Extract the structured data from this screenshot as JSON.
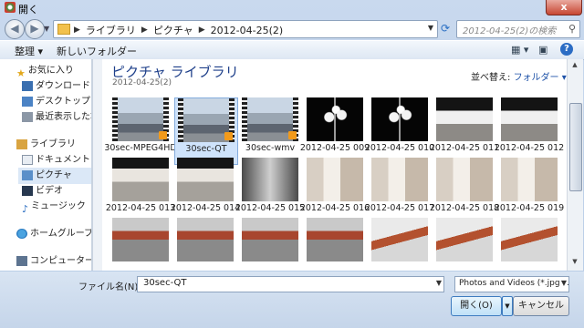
{
  "window": {
    "title": "開く",
    "close_label": "x"
  },
  "nav": {
    "back_icon": "back-arrow-icon",
    "forward_icon": "forward-arrow-icon",
    "breadcrumbs": [
      "ライブラリ",
      "ピクチャ",
      "2012-04-25(2)"
    ],
    "search_placeholder": "2012-04-25(2)の検索"
  },
  "toolbar": {
    "organize": "整理 ▾",
    "new_folder": "新しいフォルダー"
  },
  "sidebar": {
    "items": [
      {
        "label": "お気に入り",
        "icon": "star-icon"
      },
      {
        "label": "ダウンロード",
        "icon": "download-folder-icon"
      },
      {
        "label": "デスクトップ",
        "icon": "desktop-icon"
      },
      {
        "label": "最近表示した場所",
        "icon": "recent-places-icon"
      },
      {
        "label": "ライブラリ",
        "icon": "library-icon"
      },
      {
        "label": "ドキュメント",
        "icon": "documents-icon"
      },
      {
        "label": "ピクチャ",
        "icon": "pictures-icon"
      },
      {
        "label": "ビデオ",
        "icon": "videos-icon"
      },
      {
        "label": "ミュージック",
        "icon": "music-icon"
      },
      {
        "label": "ホームグループ",
        "icon": "homegroup-icon"
      },
      {
        "label": "コンピューター",
        "icon": "computer-icon"
      }
    ]
  },
  "main": {
    "library_title": "ピクチャ ライブラリ",
    "library_sub": "2012-04-25(2)",
    "arrange_label": "並べ替え:",
    "arrange_value": "フォルダー ▾",
    "files": [
      {
        "name": "30sec-MPEG4HD",
        "kind": "video"
      },
      {
        "name": "30sec-QT",
        "kind": "video",
        "selected": true
      },
      {
        "name": "30sec-wmv",
        "kind": "video"
      },
      {
        "name": "2012-04-25 009",
        "kind": "lamp"
      },
      {
        "name": "2012-04-25 010",
        "kind": "lamp"
      },
      {
        "name": "2012-04-25 011",
        "kind": "station"
      },
      {
        "name": "2012-04-25 012",
        "kind": "station"
      },
      {
        "name": "2012-04-25 013",
        "kind": "station2"
      },
      {
        "name": "2012-04-25 014",
        "kind": "station2"
      },
      {
        "name": "2012-04-25 015",
        "kind": "hall"
      },
      {
        "name": "2012-04-25 016",
        "kind": "sign"
      },
      {
        "name": "2012-04-25 017",
        "kind": "sign"
      },
      {
        "name": "2012-04-25 018",
        "kind": "sign"
      },
      {
        "name": "2012-04-25 019",
        "kind": "sign"
      },
      {
        "name": "",
        "kind": "bench"
      },
      {
        "name": "",
        "kind": "bench"
      },
      {
        "name": "",
        "kind": "bench"
      },
      {
        "name": "",
        "kind": "bench"
      },
      {
        "name": "",
        "kind": "bench2"
      },
      {
        "name": "",
        "kind": "bench2"
      },
      {
        "name": "",
        "kind": "bench2"
      }
    ]
  },
  "footer": {
    "filename_label": "ファイル名(N):",
    "filename_value": "30sec-QT",
    "filter_value": "Photos and Videos (*.jpg;*.jpeg;",
    "open_label": "開く(O)",
    "cancel_label": "キャンセル"
  }
}
